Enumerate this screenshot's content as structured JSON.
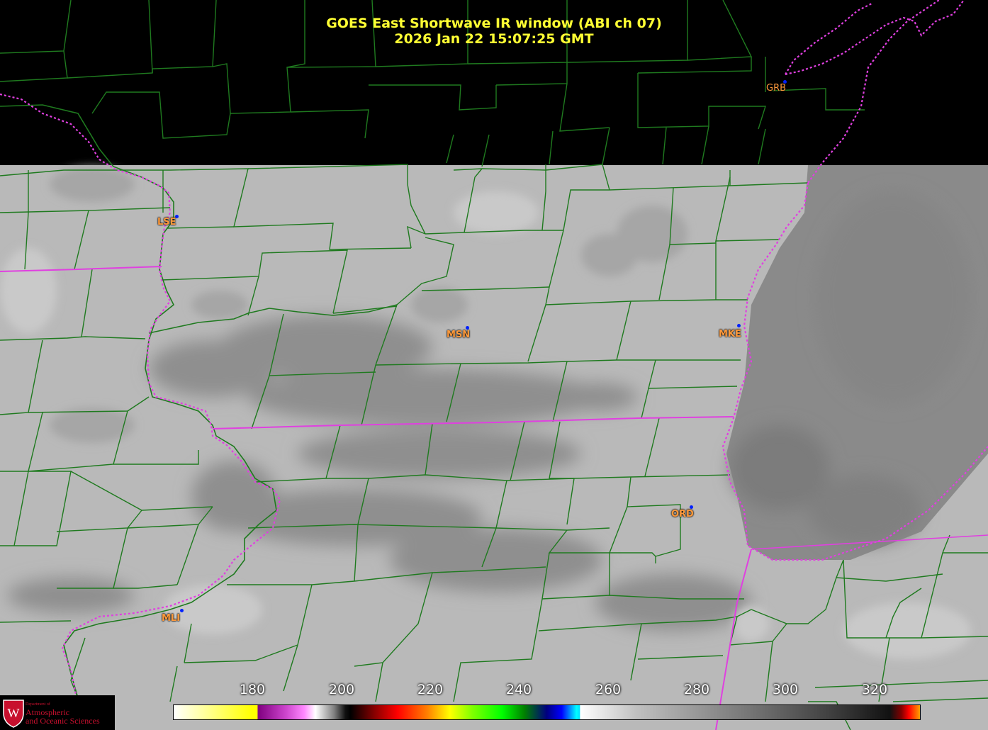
{
  "title": {
    "line1": "GOES East Shortwave IR window (ABI ch 07)",
    "line2": "2026 Jan 22  15:07:25 GMT"
  },
  "stations": [
    {
      "id": "GRB",
      "color": "#ff9a3c"
    },
    {
      "id": "LSE",
      "color": "#ff9a3c"
    },
    {
      "id": "MSN",
      "color": "#ff9a3c"
    },
    {
      "id": "MKE",
      "color": "#ff9a3c"
    },
    {
      "id": "ORD",
      "color": "#ff9a3c"
    },
    {
      "id": "MLI",
      "color": "#ff9a3c"
    }
  ],
  "colorbar": {
    "ticks": [
      "180",
      "200",
      "220",
      "240",
      "260",
      "280",
      "300",
      "320"
    ]
  },
  "logo": {
    "line1": "Department of",
    "line2": "Atmospheric",
    "line3": "and Oceanic Sciences",
    "crest_letter": "W"
  },
  "colors": {
    "county_lines": "#1f7a1f",
    "state_lines": "#e040e0",
    "background": "#000000",
    "title": "#ffff33",
    "label": "#ff9a3c",
    "station_dot": "#0020ff"
  }
}
